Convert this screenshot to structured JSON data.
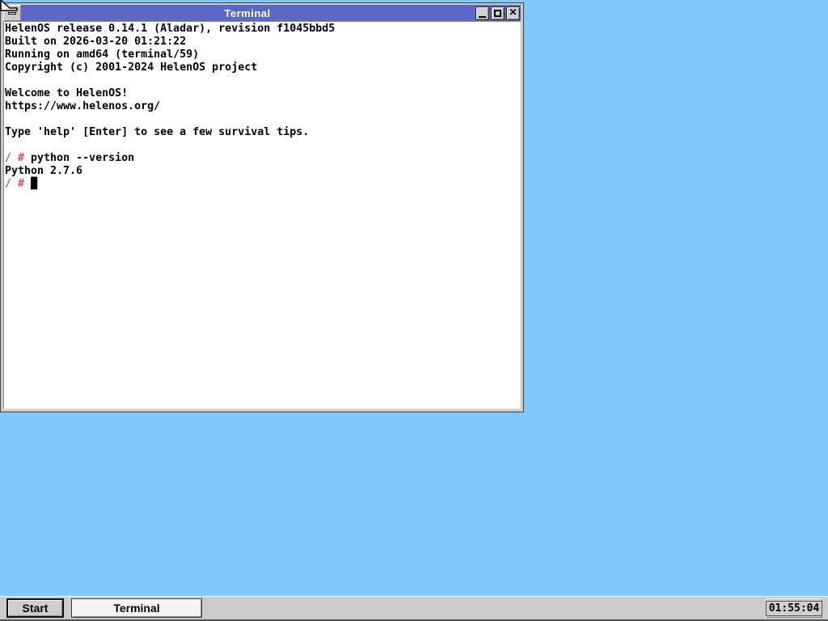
{
  "window": {
    "title": "Terminal",
    "controls": {
      "sysmenu_icon": "window-menu-icon",
      "minimize_icon": "minimize-icon",
      "maximize_icon": "maximize-icon",
      "close_icon": "close-icon",
      "close_glyph": "✕"
    }
  },
  "terminal": {
    "prompt": "/ #",
    "cursor_glyph": "█",
    "lines": [
      {
        "segments": [
          {
            "t": "HelenOS release 0.14.1 (Aladar), revision f1045bbd5"
          }
        ]
      },
      {
        "segments": [
          {
            "t": "Built on 2026-03-20 01:21:22"
          }
        ]
      },
      {
        "segments": [
          {
            "t": "Running on amd64 (terminal/59)"
          }
        ]
      },
      {
        "segments": [
          {
            "t": "Copyright (c) 2001-2024 HelenOS project"
          }
        ]
      },
      {
        "segments": []
      },
      {
        "segments": [
          {
            "t": "Welcome to HelenOS!"
          }
        ]
      },
      {
        "segments": [
          {
            "t": "https://www.helenos.org/"
          }
        ]
      },
      {
        "segments": []
      },
      {
        "segments": [
          {
            "t": "Type 'help' [Enter] to see a few survival tips."
          }
        ]
      },
      {
        "segments": []
      },
      {
        "segments": [
          {
            "t": "/ #",
            "c": "prompt"
          },
          {
            "t": " python --version"
          }
        ]
      },
      {
        "segments": [
          {
            "t": "Python 2.7.6"
          }
        ]
      },
      {
        "segments": [
          {
            "t": "/ # ",
            "c": "prompt"
          },
          {
            "t": "█",
            "c": "cursor"
          }
        ]
      }
    ],
    "colors": {
      "prompt": "#d65050",
      "cursor": "#000000",
      "background": "#ffffff",
      "text": "#000000"
    }
  },
  "taskbar": {
    "start_label": "Start",
    "window_buttons": [
      {
        "label": "Terminal",
        "active": true
      }
    ],
    "clock": "01:55:04"
  },
  "theme": {
    "desktop": "#82c9fb",
    "titlebar": "#5a68c6",
    "title_text": "#ffffff",
    "chrome": "#cbcbcb"
  }
}
